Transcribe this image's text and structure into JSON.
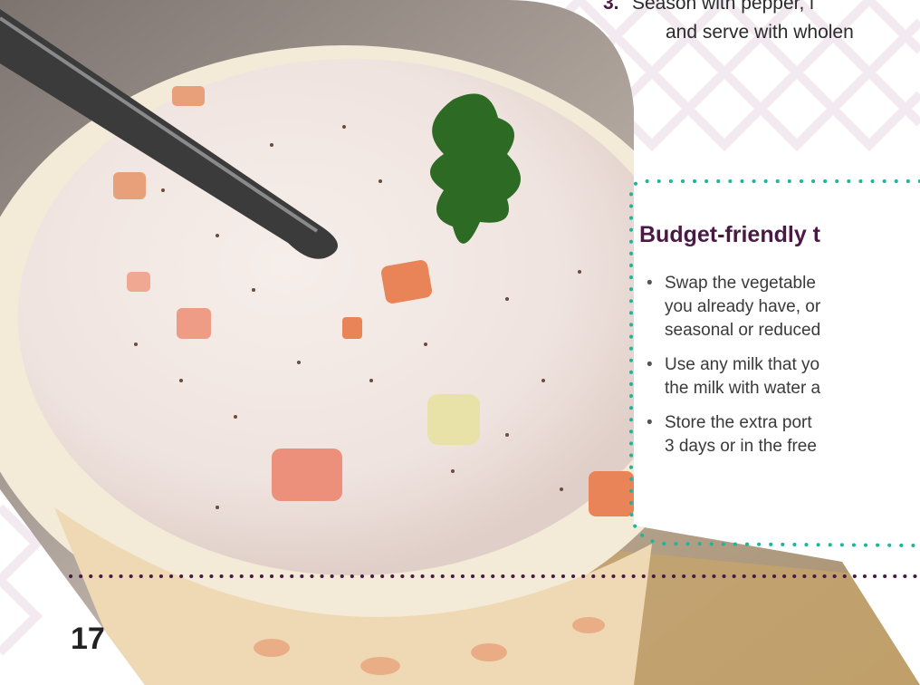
{
  "instructions": {
    "step_number": "3.",
    "step_text_line1": "Season with pepper, i",
    "step_text_line2": "and serve with wholen"
  },
  "tips": {
    "heading": "Budget-friendly t",
    "items": [
      "Swap the vegetable\nyou already have, or\nseasonal or reduced",
      "Use any milk that yo\nthe milk with water a",
      "Store the extra port\n3 days or in the free"
    ]
  },
  "page": {
    "number": "17"
  },
  "colors": {
    "accent_teal": "#1fb59a",
    "heading_purple": "#4a1a45",
    "divider_purple": "#4a1a45"
  },
  "photo": {
    "subject": "bowl-of-creamy-vegetable-soup"
  }
}
